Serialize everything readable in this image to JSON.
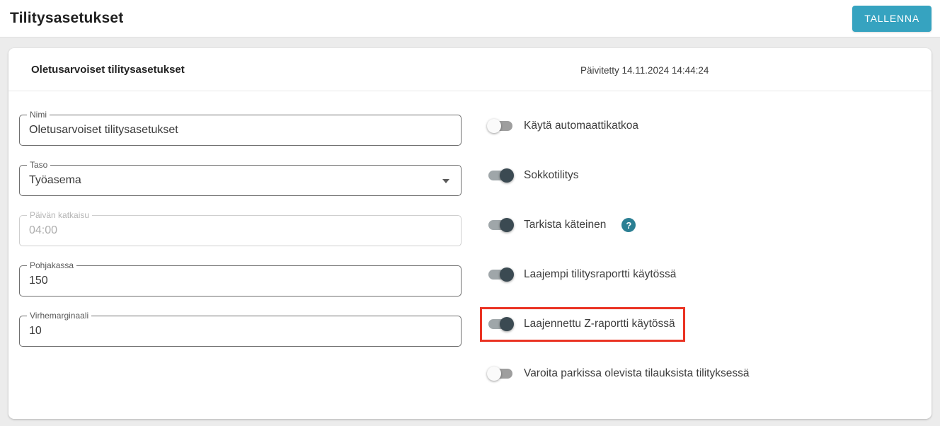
{
  "header": {
    "title": "Tilitysasetukset",
    "save_button": "TALLENNA"
  },
  "card": {
    "title": "Oletusarvoiset tilitysasetukset",
    "updated_text": "Päivitetty 14.11.2024 14:44:24"
  },
  "fields": [
    {
      "label": "Nimi",
      "value": "Oletusarvoiset tilitysasetukset",
      "type": "text",
      "disabled": false
    },
    {
      "label": "Taso",
      "value": "Työasema",
      "type": "select",
      "disabled": false
    },
    {
      "label": "Päivän katkaisu",
      "value": "04:00",
      "type": "text",
      "disabled": true
    },
    {
      "label": "Pohjakassa",
      "value": "150",
      "type": "text",
      "disabled": false
    },
    {
      "label": "Virhemarginaali",
      "value": "10",
      "type": "text",
      "disabled": false
    }
  ],
  "toggles": [
    {
      "label": "Käytä automaattikatkoa",
      "on": false,
      "help": false,
      "highlighted": false
    },
    {
      "label": "Sokkotilitys",
      "on": true,
      "help": false,
      "highlighted": false
    },
    {
      "label": "Tarkista käteinen",
      "on": true,
      "help": true,
      "highlighted": false
    },
    {
      "label": "Laajempi tilitysraportti käytössä",
      "on": true,
      "help": false,
      "highlighted": false
    },
    {
      "label": "Laajennettu Z-raportti käytössä",
      "on": true,
      "help": false,
      "highlighted": true
    },
    {
      "label": "Varoita parkissa olevista tilauksista tilityksessä",
      "on": false,
      "help": false,
      "highlighted": false
    }
  ],
  "icons": {
    "help_glyph": "?"
  },
  "colors": {
    "accent_teal": "#36a3c0",
    "help_icon_teal": "#2b7f93",
    "highlight_red": "#ea3323",
    "toggle_on_thumb": "#3b4a52",
    "toggle_on_track": "#9fa6a9",
    "toggle_off_thumb": "#fafafa",
    "toggle_off_track": "#9e9e9e",
    "page_background": "#ececec"
  }
}
